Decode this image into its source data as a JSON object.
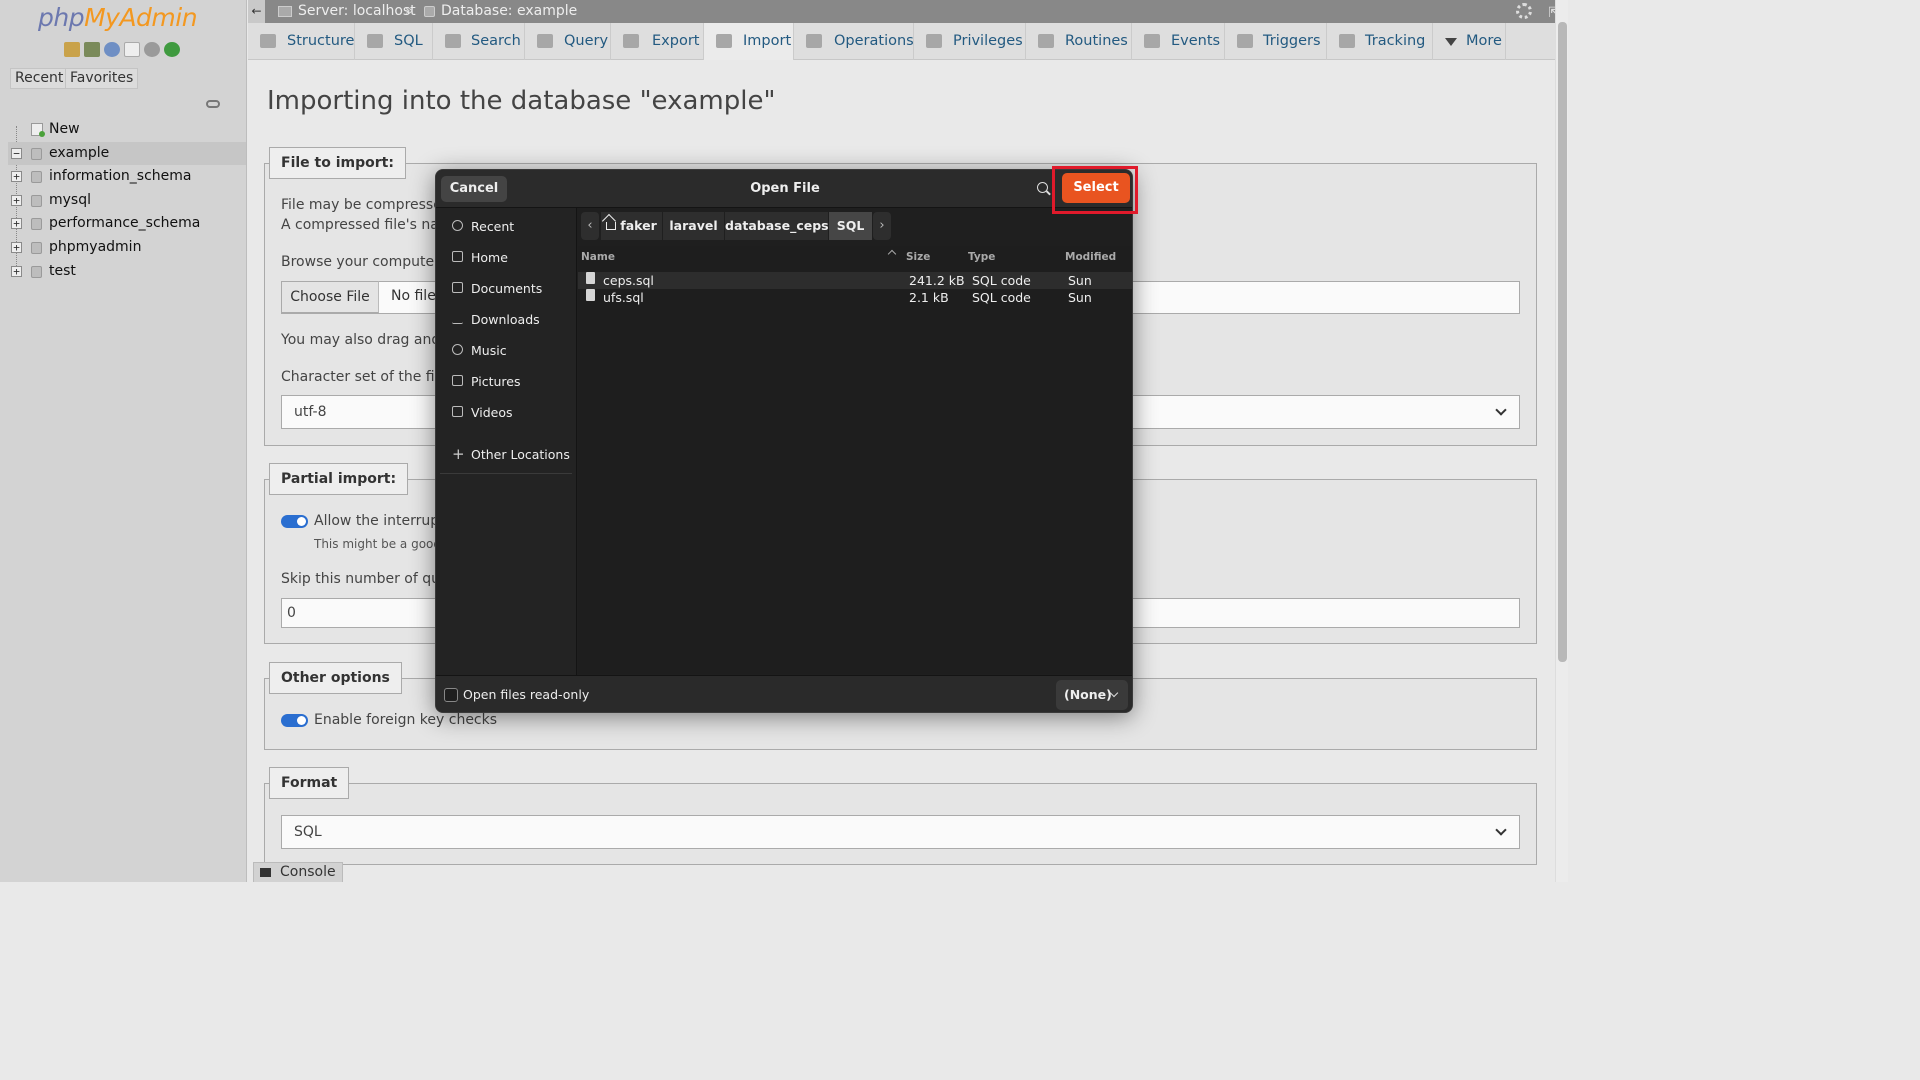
{
  "app": {
    "logo_php": "php",
    "logo_myadmin": "MyAdmin",
    "colors": {
      "logo_php": "#6c78af",
      "logo_myadmin": "#f39820",
      "link": "#235a81",
      "accent": "#e95420",
      "highlight": "#e01a2b"
    }
  },
  "nav": {
    "tabs": {
      "recent": "Recent",
      "favorites": "Favorites"
    },
    "tree": [
      {
        "label": "New"
      },
      {
        "label": "example"
      },
      {
        "label": "information_schema"
      },
      {
        "label": "mysql"
      },
      {
        "label": "performance_schema"
      },
      {
        "label": "phpmyadmin"
      },
      {
        "label": "test"
      }
    ]
  },
  "breadcrumb": {
    "server": "Server: localhost",
    "separator": "»",
    "database": "Database: example"
  },
  "tabs": [
    {
      "label": "Structure"
    },
    {
      "label": "SQL"
    },
    {
      "label": "Search"
    },
    {
      "label": "Query"
    },
    {
      "label": "Export"
    },
    {
      "label": "Import"
    },
    {
      "label": "Operations"
    },
    {
      "label": "Privileges"
    },
    {
      "label": "Routines"
    },
    {
      "label": "Events"
    },
    {
      "label": "Triggers"
    },
    {
      "label": "Tracking"
    },
    {
      "label": "More"
    }
  ],
  "main": {
    "title": "Importing into the database \"example\"",
    "file_section": {
      "legend": "File to import:",
      "line1": "File may be compressed (",
      "line2": "A compressed file's name",
      "browse": "Browse your computer: (M",
      "choose_file": "Choose File",
      "no_file": "No file c",
      "drag": "You may also drag and dr",
      "charset_label": "Character set of the file:",
      "charset_value": "utf-8"
    },
    "partial_section": {
      "legend": "Partial import:",
      "allow": "Allow the interruption",
      "hint": "This might be a good w",
      "skip_label": "Skip this number of querie",
      "skip_value": "0"
    },
    "other_section": {
      "legend": "Other options",
      "fk": "Enable foreign key checks"
    },
    "format_section": {
      "legend": "Format",
      "value": "SQL"
    },
    "console": "Console"
  },
  "dialog": {
    "title": "Open File",
    "cancel": "Cancel",
    "select": "Select",
    "places": [
      {
        "label": "Recent",
        "icon": "clock-icon"
      },
      {
        "label": "Home",
        "icon": "home-icon"
      },
      {
        "label": "Documents",
        "icon": "document-icon"
      },
      {
        "label": "Downloads",
        "icon": "download-icon"
      },
      {
        "label": "Music",
        "icon": "music-icon"
      },
      {
        "label": "Pictures",
        "icon": "picture-icon"
      },
      {
        "label": "Videos",
        "icon": "video-icon"
      }
    ],
    "other_locations": "Other Locations",
    "path": [
      "faker",
      "laravel",
      "database_ceps",
      "SQL"
    ],
    "columns": {
      "name": "Name",
      "size": "Size",
      "type": "Type",
      "modified": "Modified"
    },
    "files": [
      {
        "name": "ceps.sql",
        "size": "241.2 kB",
        "type": "SQL code",
        "modified": "Sun"
      },
      {
        "name": "ufs.sql",
        "size": "2.1 kB",
        "type": "SQL code",
        "modified": "Sun"
      }
    ],
    "readonly": "Open files read-only",
    "filter": "(None)"
  }
}
